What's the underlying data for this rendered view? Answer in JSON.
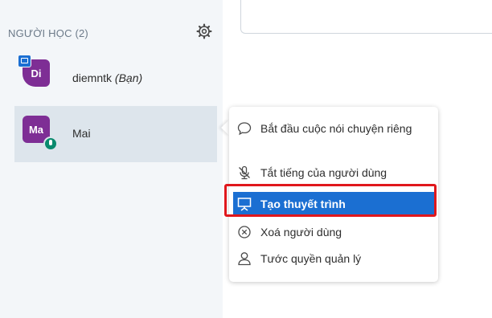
{
  "sidebar": {
    "header": "NGƯỜI HỌC (2)",
    "users": [
      {
        "initials": "Di",
        "name": "diemntk",
        "you_label": "(Bạn)",
        "avatar_color": "#7e2e95",
        "presenter": true
      },
      {
        "initials": "Ma",
        "name": "Mai",
        "avatar_color": "#7e2e95",
        "mic_active": true
      }
    ]
  },
  "context_menu": {
    "items": [
      {
        "label": "Bắt đầu cuộc nói chuyện riêng",
        "icon": "chat-bubble-icon"
      },
      {
        "label": "Tắt tiếng của người dùng",
        "icon": "mic-off-icon"
      },
      {
        "label": "Tạo thuyết trình",
        "icon": "presentation-icon",
        "selected": true
      },
      {
        "label": "Xoá người dùng",
        "icon": "remove-circle-icon"
      },
      {
        "label": "Tước quyền quản lý",
        "icon": "user-icon"
      }
    ]
  },
  "colors": {
    "accent": "#1b6fd2",
    "avatar": "#7e2e95",
    "highlight_border": "#e0171c",
    "sidebar_bg": "#f3f6f9"
  }
}
